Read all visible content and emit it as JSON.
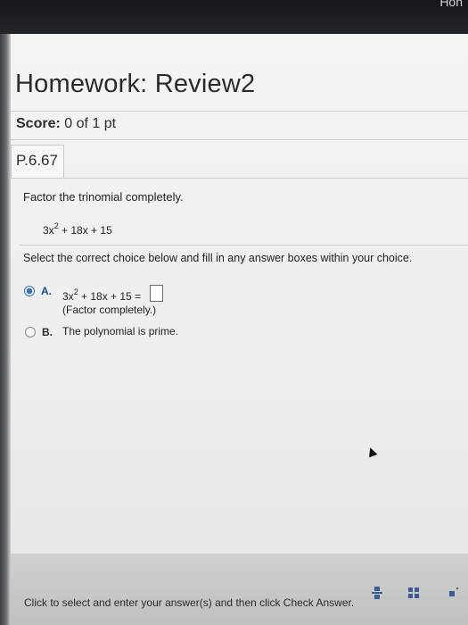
{
  "bezel": {
    "corner_text": "Hon"
  },
  "header": {
    "title": "Homework: Review2",
    "score_label": "Score:",
    "score_value": "0 of 1 pt"
  },
  "question": {
    "id": "P.6.67",
    "instruction": "Factor the trinomial completely.",
    "expression": {
      "coef": "3x",
      "exp": "2",
      "rest": " + 18x + 15"
    },
    "select_text": "Select the correct choice below and fill in any answer boxes within your choice.",
    "choices": [
      {
        "letter": "A.",
        "expr_coef": "3x",
        "expr_exp": "2",
        "expr_rest": " + 18x + 15 =",
        "note": "(Factor completely.)",
        "selected": true
      },
      {
        "letter": "B.",
        "text": "The polynomial is prime.",
        "selected": false
      }
    ]
  },
  "footer": {
    "status_text": "Click to select and enter your answer(s) and then click Check Answer."
  },
  "colors": {
    "accent": "#3b73b9",
    "text": "#222222"
  },
  "icons": [
    "fraction-icon",
    "matrix-icon",
    "more-icon",
    "cursor-icon",
    "radio-selected-icon",
    "radio-icon"
  ]
}
